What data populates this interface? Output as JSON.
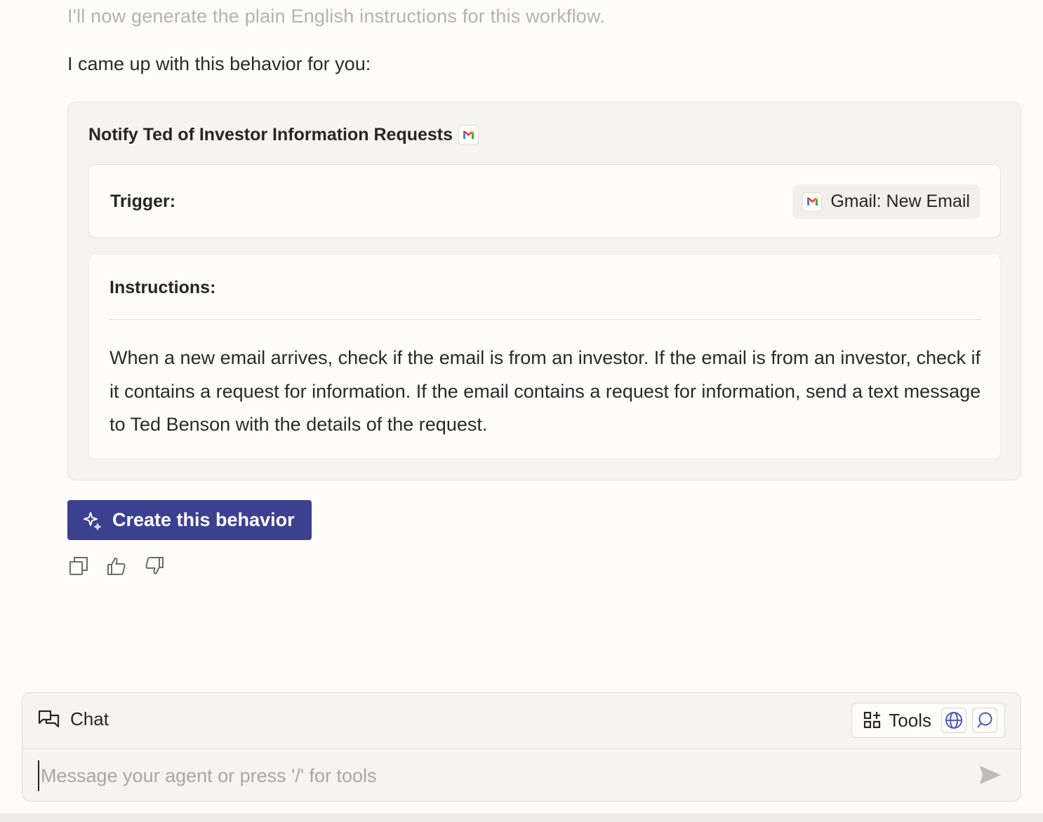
{
  "messages": {
    "faded_line": "I'll now generate the plain English instructions for this workflow.",
    "intro": "I came up with this behavior for you:"
  },
  "behavior_card": {
    "title": "Notify Ted of Investor Information Requests",
    "title_icon": "gmail-icon",
    "trigger_label": "Trigger:",
    "trigger_value": "Gmail: New Email",
    "trigger_icon": "gmail-icon",
    "instructions_label": "Instructions:",
    "instructions_text": "When a new email arrives, check if the email is from an investor. If the email is from an investor, check if it contains a request for information. If the email contains a request for information, send a text message to Ted Benson with the details of the request."
  },
  "actions": {
    "create_label": "Create this behavior",
    "create_icon": "sparkle-icon",
    "feedback_icons": [
      "copy-icon",
      "thumbs-up-icon",
      "thumbs-down-icon"
    ]
  },
  "chat": {
    "title": "Chat",
    "title_icon": "chat-icon",
    "tools_label": "Tools",
    "tools_icon": "tools-grid-icon",
    "tool_buttons": [
      "globe-icon",
      "search-icon"
    ],
    "input_placeholder": "Message your agent or press '/' for tools",
    "input_value": "",
    "send_icon": "send-icon"
  },
  "colors": {
    "background": "#fdfcf9",
    "accent": "#3c418f",
    "tool_icon": "#4b5bb8"
  }
}
